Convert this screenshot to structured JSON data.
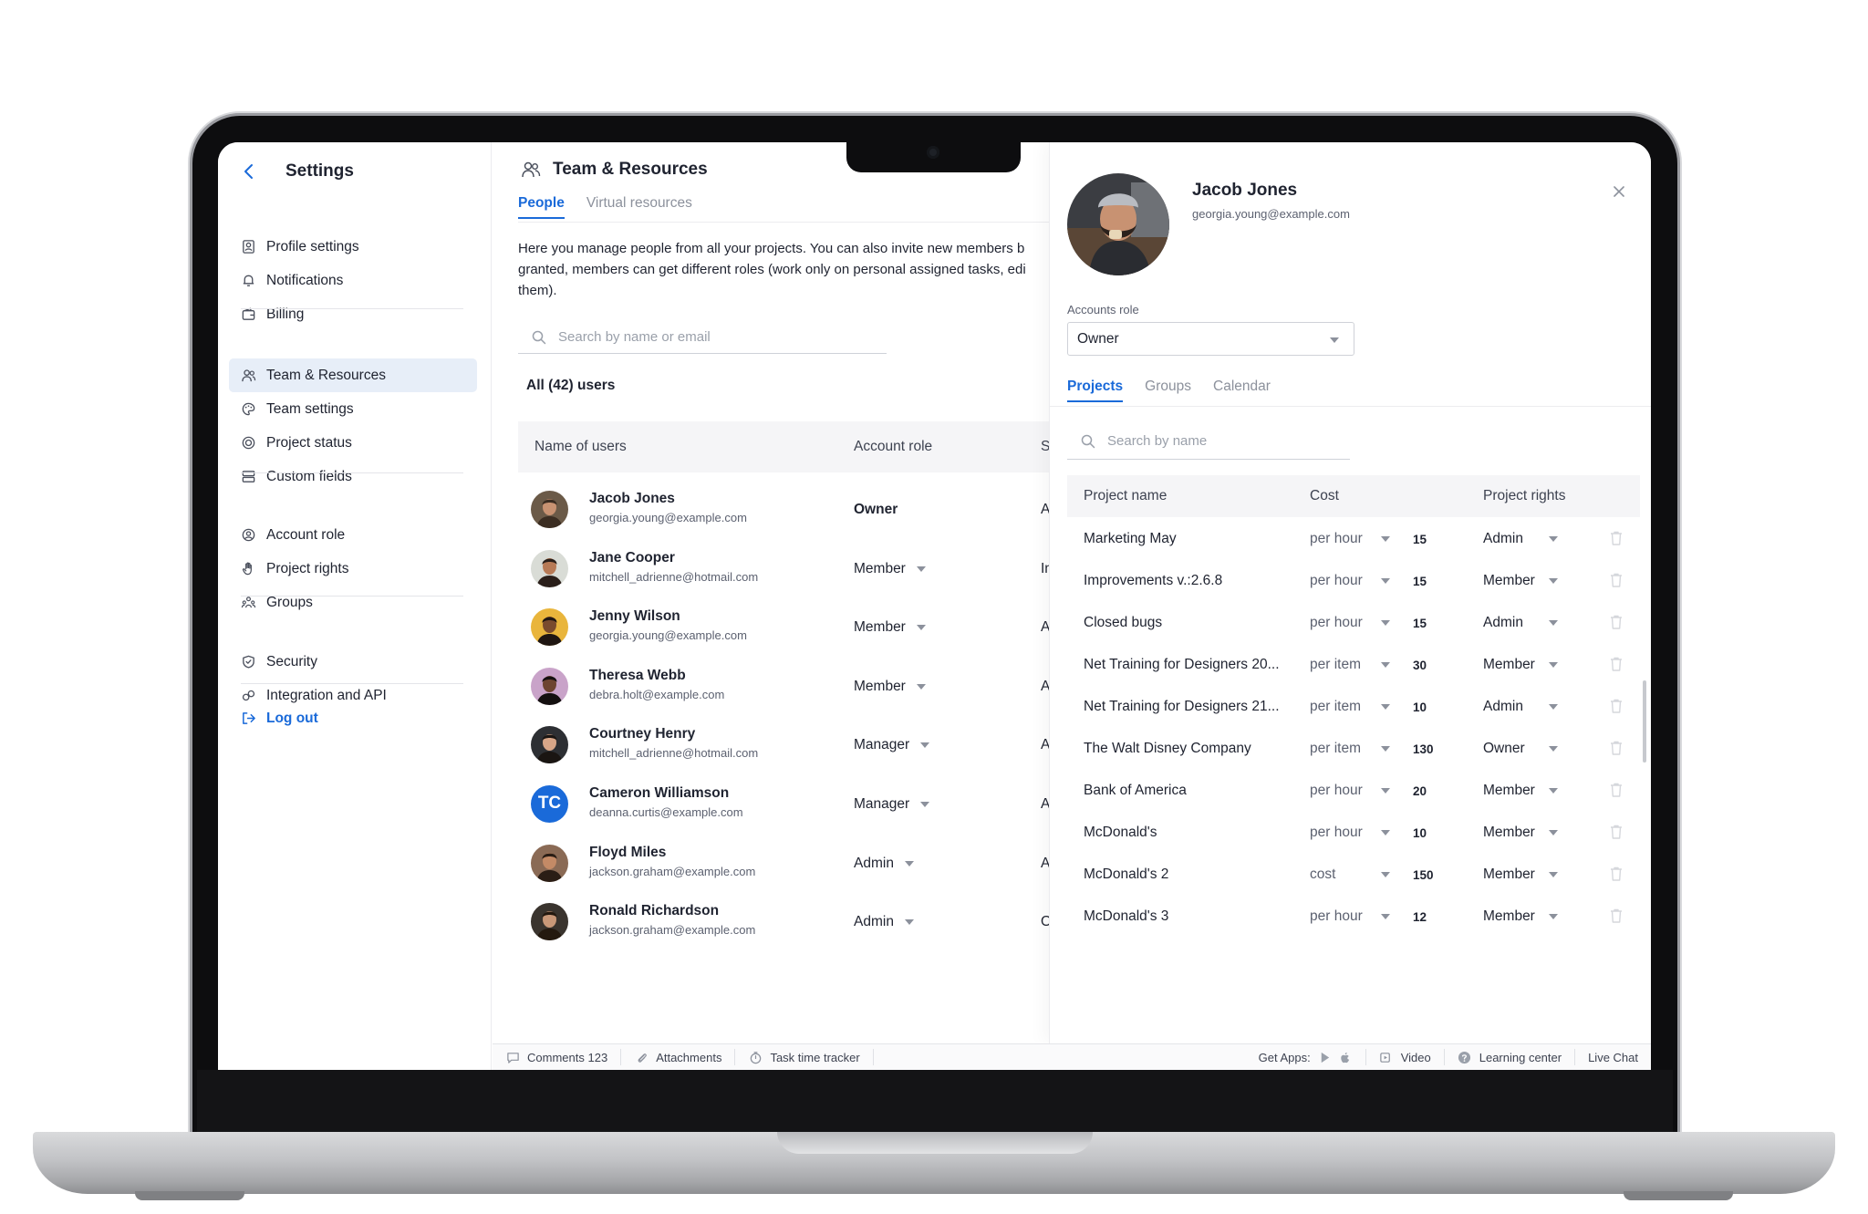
{
  "sidebar": {
    "title": "Settings",
    "groups": [
      [
        {
          "label": "Profile settings",
          "icon": "profile-icon"
        },
        {
          "label": "Notifications",
          "icon": "bell-icon"
        },
        {
          "label": "Billing",
          "icon": "wallet-icon"
        }
      ],
      [
        {
          "label": "Team & Resources",
          "icon": "users-icon",
          "active": true
        },
        {
          "label": "Team settings",
          "icon": "palette-icon"
        },
        {
          "label": "Project status",
          "icon": "status-icon"
        },
        {
          "label": "Custom fields",
          "icon": "fields-icon"
        }
      ],
      [
        {
          "label": "Account role",
          "icon": "user-circle-icon"
        },
        {
          "label": "Project rights",
          "icon": "hand-icon"
        },
        {
          "label": "Groups",
          "icon": "group-icon"
        }
      ],
      [
        {
          "label": "Security",
          "icon": "shield-icon"
        },
        {
          "label": "Integration and API",
          "icon": "integration-icon"
        }
      ]
    ],
    "logout": "Log out"
  },
  "main": {
    "title": "Team & Resources",
    "tabs": [
      {
        "label": "People",
        "active": true
      },
      {
        "label": "Virtual resources",
        "active": false
      }
    ],
    "intro": "Here you manage people from all your projects. You can also invite new members b\ngranted, members can get different roles (work only on personal assigned tasks, edi\nthem).",
    "search_placeholder": "Search by name or email",
    "count": "All (42) users",
    "columns": [
      "Name of users",
      "Account role",
      "St"
    ],
    "users": [
      {
        "name": "Jacob Jones",
        "email": "georgia.young@example.com",
        "role": "Owner",
        "status": "A",
        "avatar": "photo"
      },
      {
        "name": "Jane Cooper",
        "email": "mitchell_adrienne@hotmail.com",
        "role": "Member",
        "status": "In",
        "avatar": "photo"
      },
      {
        "name": "Jenny Wilson",
        "email": "georgia.young@example.com",
        "role": "Member",
        "status": "A",
        "avatar": "photo"
      },
      {
        "name": "Theresa Webb",
        "email": "debra.holt@example.com",
        "role": "Member",
        "status": "A",
        "avatar": "photo"
      },
      {
        "name": "Courtney Henry",
        "email": "mitchell_adrienne@hotmail.com",
        "role": "Manager",
        "status": "A",
        "avatar": "photo"
      },
      {
        "name": "Cameron Williamson",
        "email": "deanna.curtis@example.com",
        "role": "Manager",
        "status": "A",
        "avatar": "initials",
        "initials": "TC"
      },
      {
        "name": "Floyd Miles",
        "email": "jackson.graham@example.com",
        "role": "Admin",
        "status": "A",
        "avatar": "photo"
      },
      {
        "name": "Ronald Richardson",
        "email": "jackson.graham@example.com",
        "role": "Admin",
        "status": "O",
        "avatar": "photo"
      }
    ]
  },
  "bottombar": {
    "comments": "Comments",
    "comments_count": "123",
    "attachments": "Attachments",
    "tracker": "Task time tracker",
    "get_apps": "Get Apps:",
    "video": "Video",
    "learning": "Learning center",
    "chat": "Live Chat"
  },
  "panel": {
    "name": "Jacob Jones",
    "email": "georgia.young@example.com",
    "role_label": "Accounts role",
    "role_value": "Owner",
    "tabs": [
      {
        "label": "Projects",
        "active": true
      },
      {
        "label": "Groups",
        "active": false
      },
      {
        "label": "Calendar",
        "active": false
      }
    ],
    "search_placeholder": "Search by name",
    "columns": {
      "name": "Project name",
      "cost": "Cost",
      "rights": "Project rights"
    },
    "projects": [
      {
        "name": "Marketing May",
        "cost": "per hour",
        "value": "15",
        "rights": "Admin"
      },
      {
        "name": "Improvements v.:2.6.8",
        "cost": "per hour",
        "value": "15",
        "rights": "Member"
      },
      {
        "name": "Closed bugs",
        "cost": "per hour",
        "value": "15",
        "rights": "Admin"
      },
      {
        "name": "Net Training for Designers 20...",
        "cost": "per item",
        "value": "30",
        "rights": "Member"
      },
      {
        "name": "Net Training for Designers 21...",
        "cost": "per item",
        "value": "10",
        "rights": "Admin"
      },
      {
        "name": "The Walt Disney Company",
        "cost": "per item",
        "value": "130",
        "rights": "Owner"
      },
      {
        "name": "Bank of America",
        "cost": "per hour",
        "value": "20",
        "rights": "Member"
      },
      {
        "name": "McDonald's",
        "cost": "per hour",
        "value": "10",
        "rights": "Member"
      },
      {
        "name": "McDonald's 2",
        "cost": "cost",
        "value": "150",
        "rights": "Member"
      },
      {
        "name": "McDonald's 3",
        "cost": "per hour",
        "value": "12",
        "rights": "Member"
      }
    ]
  },
  "colors": {
    "accent": "#1a6ad9",
    "active_bg": "#e7eef8",
    "header_bg": "#f5f5f7"
  }
}
